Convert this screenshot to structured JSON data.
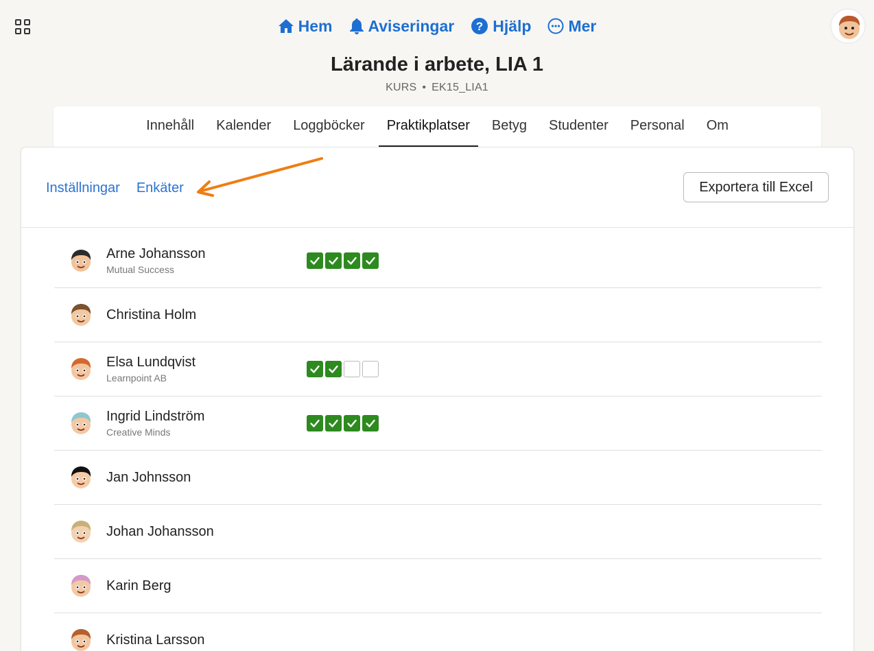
{
  "topnav": {
    "items": [
      {
        "label": "Hem",
        "icon": "home-icon"
      },
      {
        "label": "Aviseringar",
        "icon": "bell-icon"
      },
      {
        "label": "Hjälp",
        "icon": "help-icon"
      },
      {
        "label": "Mer",
        "icon": "more-icon"
      }
    ],
    "accent": "#1d6fd1"
  },
  "course": {
    "title": "Lärande i arbete, LIA 1",
    "type": "KURS",
    "code": "EK15_LIA1"
  },
  "tabs": [
    "Innehåll",
    "Kalender",
    "Loggböcker",
    "Praktikplatser",
    "Betyg",
    "Studenter",
    "Personal",
    "Om"
  ],
  "active_tab": "Praktikplatser",
  "subnav": {
    "settings": "Inställningar",
    "surveys": "Enkäter"
  },
  "export_label": "Exportera till Excel",
  "students": [
    {
      "name": "Arne Johansson",
      "company": "Mutual Success",
      "checks": [
        true,
        true,
        true,
        true
      ],
      "hair": "#2b2b2b",
      "skin": "#f1c39a"
    },
    {
      "name": "Christina Holm",
      "company": "",
      "checks": [],
      "hair": "#7a5230",
      "skin": "#f2c8a0"
    },
    {
      "name": "Elsa Lundqvist",
      "company": "Learnpoint AB",
      "checks": [
        true,
        true,
        false,
        false
      ],
      "hair": "#d26a2e",
      "skin": "#f3c6a0"
    },
    {
      "name": "Ingrid Lindström",
      "company": "Creative Minds",
      "checks": [
        true,
        true,
        true,
        true
      ],
      "hair": "#8fc7cf",
      "skin": "#f3c8a4"
    },
    {
      "name": "Jan Johnsson",
      "company": "",
      "checks": [],
      "hair": "#111111",
      "skin": "#f4cba6"
    },
    {
      "name": "Johan Johansson",
      "company": "",
      "checks": [],
      "hair": "#c8b07a",
      "skin": "#f3d1b0"
    },
    {
      "name": "Karin Berg",
      "company": "",
      "checks": [],
      "hair": "#d49ac9",
      "skin": "#f2c9a6"
    },
    {
      "name": "Kristina Larsson",
      "company": "",
      "checks": [],
      "hair": "#b4612f",
      "skin": "#f2c6a0"
    }
  ],
  "colors": {
    "check_done": "#2d8a1f",
    "link": "#2b73d1",
    "annotation_arrow": "#f07d12"
  }
}
